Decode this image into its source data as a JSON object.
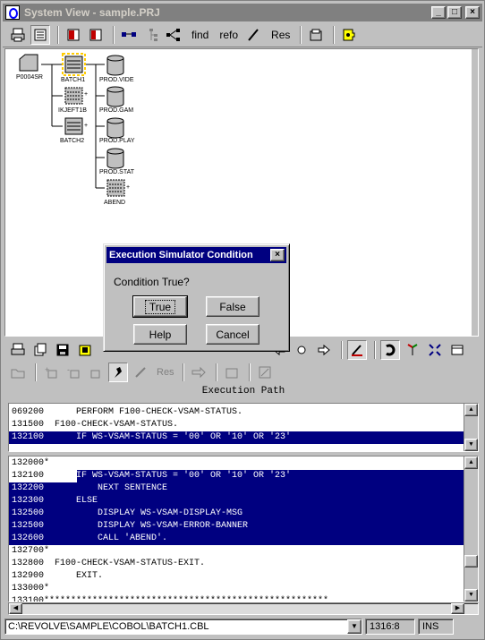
{
  "window": {
    "title": "System View - sample.PRJ",
    "controls": [
      "_",
      "□",
      "×"
    ]
  },
  "toolbar1": {
    "find_label": "find",
    "refo_label": "refo",
    "res_label": "Res"
  },
  "diagram": {
    "nodes": {
      "p0004sr": "P0004SR",
      "batch1": "BATCH1",
      "ikjeft1b": "IKJEFT1B",
      "batch2": "BATCH2",
      "prod_vide": "PROD.VIDE",
      "prod_gam": "PROD.GAM",
      "prod_play": "PROD.PLAY",
      "prod_stat": "PROD.STAT",
      "abend": "ABEND"
    }
  },
  "dialog": {
    "title": "Execution Simulator Condition",
    "close": "×",
    "message": "Condition True?",
    "true_label": "True",
    "false_label": "False",
    "help_label": "Help",
    "cancel_label": "Cancel"
  },
  "toolbar3": {
    "res_label": "Res"
  },
  "execution": {
    "title": "Execution Path",
    "path_lines": [
      "069200      PERFORM F100-CHECK-VSAM-STATUS.",
      "131500  F100-CHECK-VSAM-STATUS.",
      "132100      IF WS-VSAM-STATUS = '00' OR '10' OR '23'"
    ]
  },
  "source": {
    "lines": [
      "132000*",
      "132100      IF WS-VSAM-STATUS = '00' OR '10' OR '23'",
      "132200          NEXT SENTENCE",
      "132300      ELSE",
      "132500          DISPLAY WS-VSAM-DISPLAY-MSG",
      "132500          DISPLAY WS-VSAM-ERROR-BANNER",
      "132600          CALL 'ABEND'.",
      "132700*",
      "132800  F100-CHECK-VSAM-STATUS-EXIT.",
      "132900      EXIT.",
      "133000*",
      "133100*****************************************************"
    ],
    "line_132100_code": "IF WS-VSAM-STATUS = '00' OR '10' OR '23'",
    "line_132100_num": "132100      "
  },
  "statusbar": {
    "path": "C:\\REVOLVE\\SAMPLE\\COBOL\\BATCH1.CBL",
    "position": "1316:8",
    "mode": "INS"
  },
  "colors": {
    "selection": "#000080",
    "dialog_title": "#000080",
    "window_title_inactive": "#808080",
    "batch1_highlight": "#ffcc00"
  }
}
